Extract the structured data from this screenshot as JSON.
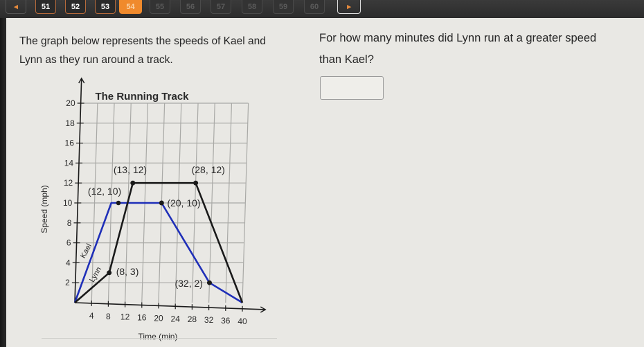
{
  "pagination": {
    "prev_icon": "◂",
    "next_icon": "▸",
    "pages": [
      {
        "label": "51",
        "state": "done"
      },
      {
        "label": "52",
        "state": "done"
      },
      {
        "label": "53",
        "state": "done"
      },
      {
        "label": "54",
        "state": "active"
      },
      {
        "label": "55",
        "state": "future"
      },
      {
        "label": "56",
        "state": "future"
      },
      {
        "label": "57",
        "state": "future"
      },
      {
        "label": "58",
        "state": "future"
      },
      {
        "label": "59",
        "state": "future"
      },
      {
        "label": "60",
        "state": "future"
      }
    ]
  },
  "passage": {
    "line1": "The graph below represents the speeds of Kael and",
    "line2": "Lynn as they run around a track."
  },
  "question": {
    "line1": "For how many minutes did Lynn run at a greater speed",
    "line2": "than Kael?"
  },
  "answer": {
    "value": ""
  },
  "colors": {
    "kael": "#1f2fb8",
    "lynn": "#1a1a1a",
    "grid": "#a9a9a6",
    "accent": "#f08a2c"
  },
  "chart_data": {
    "type": "line",
    "title": "The Running Track",
    "xlabel": "Time (min)",
    "ylabel": "Speed (mph)",
    "xlim": [
      0,
      40
    ],
    "ylim": [
      0,
      20
    ],
    "x_ticks": [
      4,
      8,
      12,
      16,
      20,
      24,
      28,
      32,
      36,
      40
    ],
    "y_ticks": [
      2,
      4,
      6,
      8,
      10,
      12,
      14,
      16,
      18,
      20
    ],
    "grid": true,
    "series": [
      {
        "name": "Kael",
        "color": "#1f2fb8",
        "points": [
          [
            0,
            0
          ],
          [
            8,
            10
          ],
          [
            20,
            10
          ],
          [
            32,
            2
          ],
          [
            40,
            0
          ]
        ],
        "marked": [
          [
            20,
            10
          ],
          [
            32,
            2
          ]
        ]
      },
      {
        "name": "Lynn",
        "color": "#1a1a1a",
        "points": [
          [
            0,
            0
          ],
          [
            8,
            3
          ],
          [
            13,
            12
          ],
          [
            28,
            12
          ],
          [
            40,
            0
          ]
        ],
        "marked": [
          [
            8,
            3
          ],
          [
            13,
            12
          ],
          [
            28,
            12
          ]
        ]
      }
    ],
    "annotations": [
      {
        "text": "(13, 12)",
        "x": 13,
        "y": 12
      },
      {
        "text": "(28, 12)",
        "x": 28,
        "y": 12
      },
      {
        "text": "(12, 10)",
        "x": 12,
        "y": 10
      },
      {
        "text": "(20, 10)",
        "x": 20,
        "y": 10
      },
      {
        "text": "(8, 3)",
        "x": 8,
        "y": 3
      },
      {
        "text": "(32, 2)",
        "x": 32,
        "y": 2
      }
    ],
    "series_labels": [
      {
        "text": "Kael",
        "series": "Kael"
      },
      {
        "text": "Lynn",
        "series": "Lynn"
      }
    ]
  }
}
